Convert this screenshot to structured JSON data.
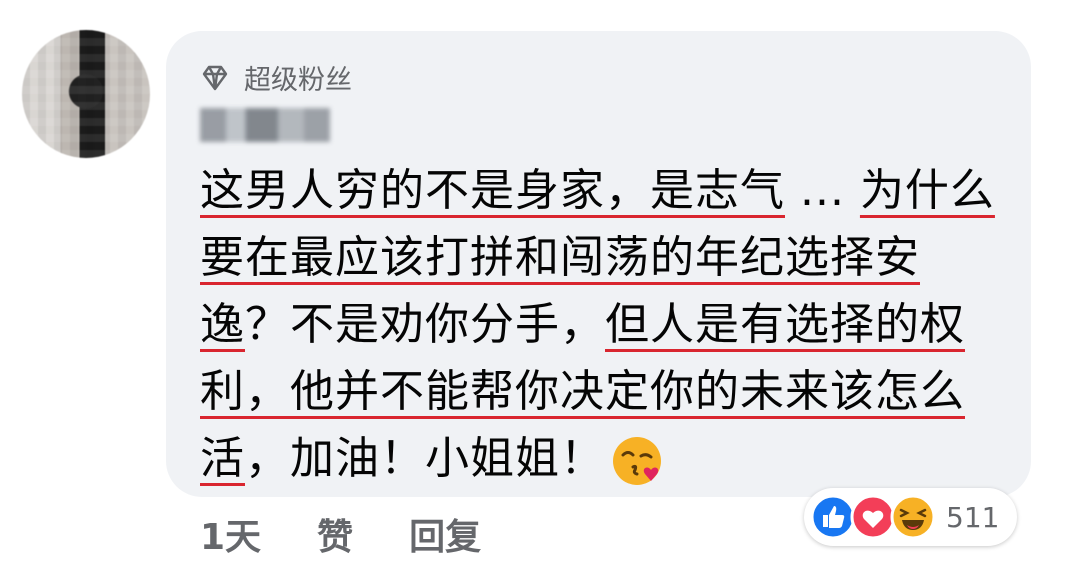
{
  "badge": {
    "label": "超级粉丝",
    "icon": "diamond-icon"
  },
  "comment": {
    "segments": [
      "这男人穷的不是身家，是志气",
      " ... ",
      "为什么要在最应该打拼和闯荡的年纪选择安逸",
      "？不是劝你分手，",
      "但人是有选择的权利，他并不能帮你决定你的未来该怎么活",
      "，加油！小姐姐！"
    ],
    "emoji": "kissing-heart-emoji"
  },
  "actions": {
    "time": "1天",
    "like": "赞",
    "reply": "回复"
  },
  "reactions": {
    "types": [
      "like-icon",
      "love-icon",
      "haha-icon"
    ],
    "count": "511"
  },
  "colors": {
    "bubble": "#f0f2f5",
    "secondary_text": "#65676b",
    "underline": "#d9262f",
    "like_blue": "#1877f2",
    "love_red": "#f33e58",
    "haha_yellow": "#f7b125"
  }
}
